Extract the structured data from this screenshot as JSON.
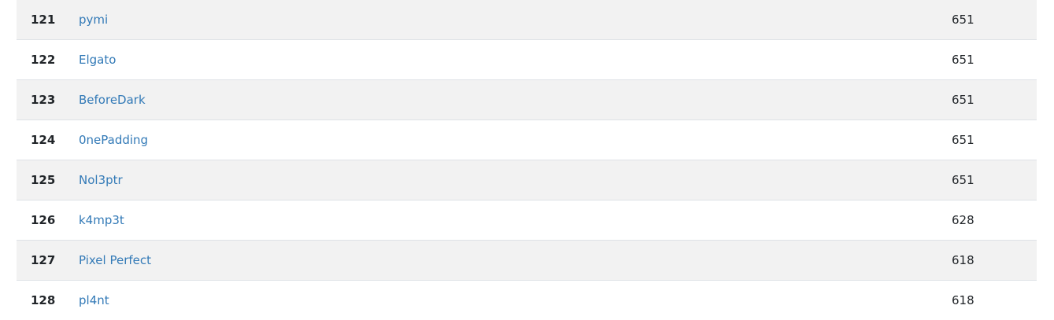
{
  "scoreboard": {
    "rows": [
      {
        "place": "121",
        "team": "pymi",
        "score": "651"
      },
      {
        "place": "122",
        "team": "Elgato",
        "score": "651"
      },
      {
        "place": "123",
        "team": "BeforeDark",
        "score": "651"
      },
      {
        "place": "124",
        "team": "0nePadding",
        "score": "651"
      },
      {
        "place": "125",
        "team": "Nol3ptr",
        "score": "651"
      },
      {
        "place": "126",
        "team": "k4mp3t",
        "score": "628"
      },
      {
        "place": "127",
        "team": "Pixel Perfect",
        "score": "618"
      },
      {
        "place": "128",
        "team": "pl4nt",
        "score": "618"
      }
    ],
    "colors": {
      "link": "#337ab7",
      "stripe": "#f2f2f2",
      "border": "#dee2e6"
    }
  }
}
